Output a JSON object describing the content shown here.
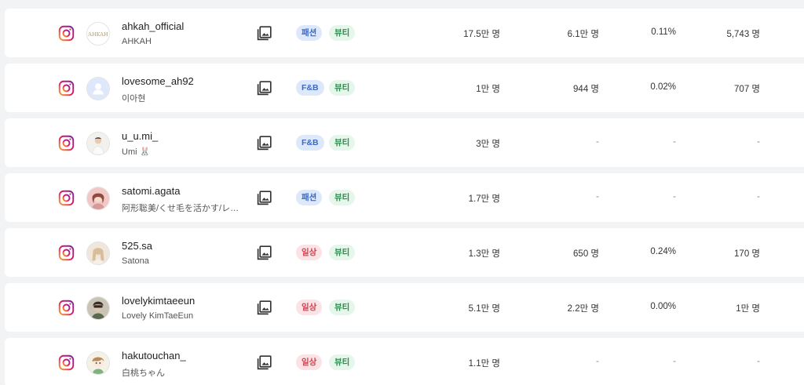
{
  "rows": [
    {
      "username": "ahkah_official",
      "display_name": "AHKAH",
      "avatar": "ahkah-logo",
      "category": "패션",
      "category_color": "blue",
      "tag": "뷰티",
      "followers": "17.5만 명",
      "avg_reach": "6.1만 명",
      "engagement": "0.11%",
      "avg_likes": "5,743 명"
    },
    {
      "username": "lovesome_ah92",
      "display_name": "이아현",
      "avatar": "default-user",
      "category": "F&B",
      "category_color": "blue",
      "tag": "뷰티",
      "followers": "1만 명",
      "avg_reach": "944 명",
      "engagement": "0.02%",
      "avg_likes": "707 명"
    },
    {
      "username": "u_u.mi_",
      "display_name": "Umi 🐰",
      "avatar": "photo-person",
      "category": "F&B",
      "category_color": "blue",
      "tag": "뷰티",
      "followers": "3만 명",
      "avg_reach": "-",
      "engagement": "-",
      "avg_likes": "-"
    },
    {
      "username": "satomi.agata",
      "display_name": "阿形聡美/くせ毛を活かす/レイ…",
      "avatar": "photo-person",
      "category": "패션",
      "category_color": "blue",
      "tag": "뷰티",
      "followers": "1.7만 명",
      "avg_reach": "-",
      "engagement": "-",
      "avg_likes": "-"
    },
    {
      "username": "525.sa",
      "display_name": "Satona",
      "avatar": "photo-person",
      "category": "일상",
      "category_color": "red",
      "tag": "뷰티",
      "followers": "1.3만 명",
      "avg_reach": "650 명",
      "engagement": "0.24%",
      "avg_likes": "170 명"
    },
    {
      "username": "lovelykimtaeeun",
      "display_name": "Lovely KimTaeEun",
      "avatar": "photo-person",
      "category": "일상",
      "category_color": "red",
      "tag": "뷰티",
      "followers": "5.1만 명",
      "avg_reach": "2.2만 명",
      "engagement": "0.00%",
      "avg_likes": "1만 명"
    },
    {
      "username": "hakutouchan_",
      "display_name": "白桃ちゃん",
      "avatar": "illustration",
      "category": "일상",
      "category_color": "red",
      "tag": "뷰티",
      "followers": "1.1만 명",
      "avg_reach": "-",
      "engagement": "-",
      "avg_likes": "-"
    }
  ],
  "icons": {
    "platform": "instagram-icon",
    "media": "image-gallery-icon"
  },
  "colors": {
    "tag_blue_bg": "#dde9fb",
    "tag_blue_text": "#3c68c7",
    "tag_red_bg": "#fbe2e4",
    "tag_red_text": "#d2434f",
    "tag_green_bg": "#e5f6ea",
    "tag_green_text": "#2e8a4c"
  }
}
